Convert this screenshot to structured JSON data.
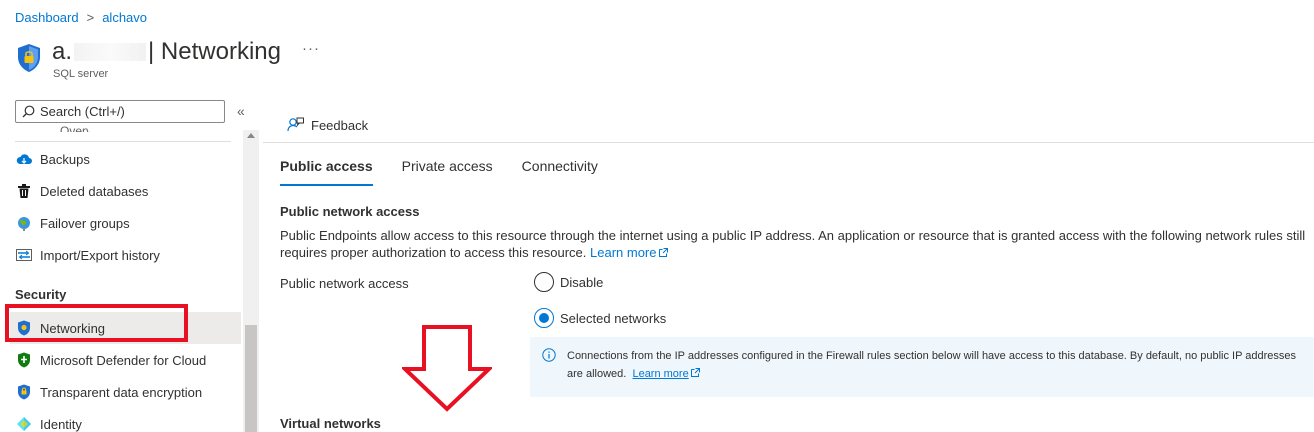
{
  "breadcrumb": [
    {
      "label": "Dashboard"
    },
    {
      "label": "alchavo"
    }
  ],
  "header": {
    "title_prefix": "a.",
    "title_suffix": "| Networking",
    "subtitle": "SQL server",
    "more": "···"
  },
  "sidebar": {
    "search": {
      "placeholder": "Search (Ctrl+/)"
    },
    "collapse": "«",
    "items": [
      {
        "label": "Backups",
        "icon": "cloud-backup-icon"
      },
      {
        "label": "Deleted databases",
        "icon": "trash-icon"
      },
      {
        "label": "Failover groups",
        "icon": "globe-icon"
      },
      {
        "label": "Import/Export history",
        "icon": "import-export-icon"
      }
    ],
    "section": "Security",
    "security_items": [
      {
        "label": "Networking",
        "icon": "shield-icon",
        "selected": true
      },
      {
        "label": "Microsoft Defender for Cloud",
        "icon": "defender-shield-icon"
      },
      {
        "label": "Transparent data encryption",
        "icon": "tde-shield-icon"
      },
      {
        "label": "Identity",
        "icon": "identity-icon"
      }
    ]
  },
  "command_bar": {
    "feedback": "Feedback"
  },
  "tabs": [
    {
      "label": "Public access",
      "active": true
    },
    {
      "label": "Private access"
    },
    {
      "label": "Connectivity"
    }
  ],
  "public_access": {
    "section_title": "Public network access",
    "description": "Public Endpoints allow access to this resource through the internet using a public IP address. An application or resource that is granted access with the following network rules still requires proper authorization to access this resource.",
    "learn_more": "Learn more",
    "field_label": "Public network access",
    "options": [
      {
        "label": "Disable",
        "selected": false
      },
      {
        "label": "Selected networks",
        "selected": true
      }
    ],
    "info": "Connections from the IP addresses configured in the Firewall rules section below will have access to this database. By default, no public IP addresses are allowed.",
    "info_learn_more": "Learn more"
  },
  "virtual_networks": {
    "title": "Virtual networks"
  },
  "colors": {
    "accent": "#0078d4",
    "annotation_red": "#e81123",
    "info_bg": "#eff6fc"
  }
}
